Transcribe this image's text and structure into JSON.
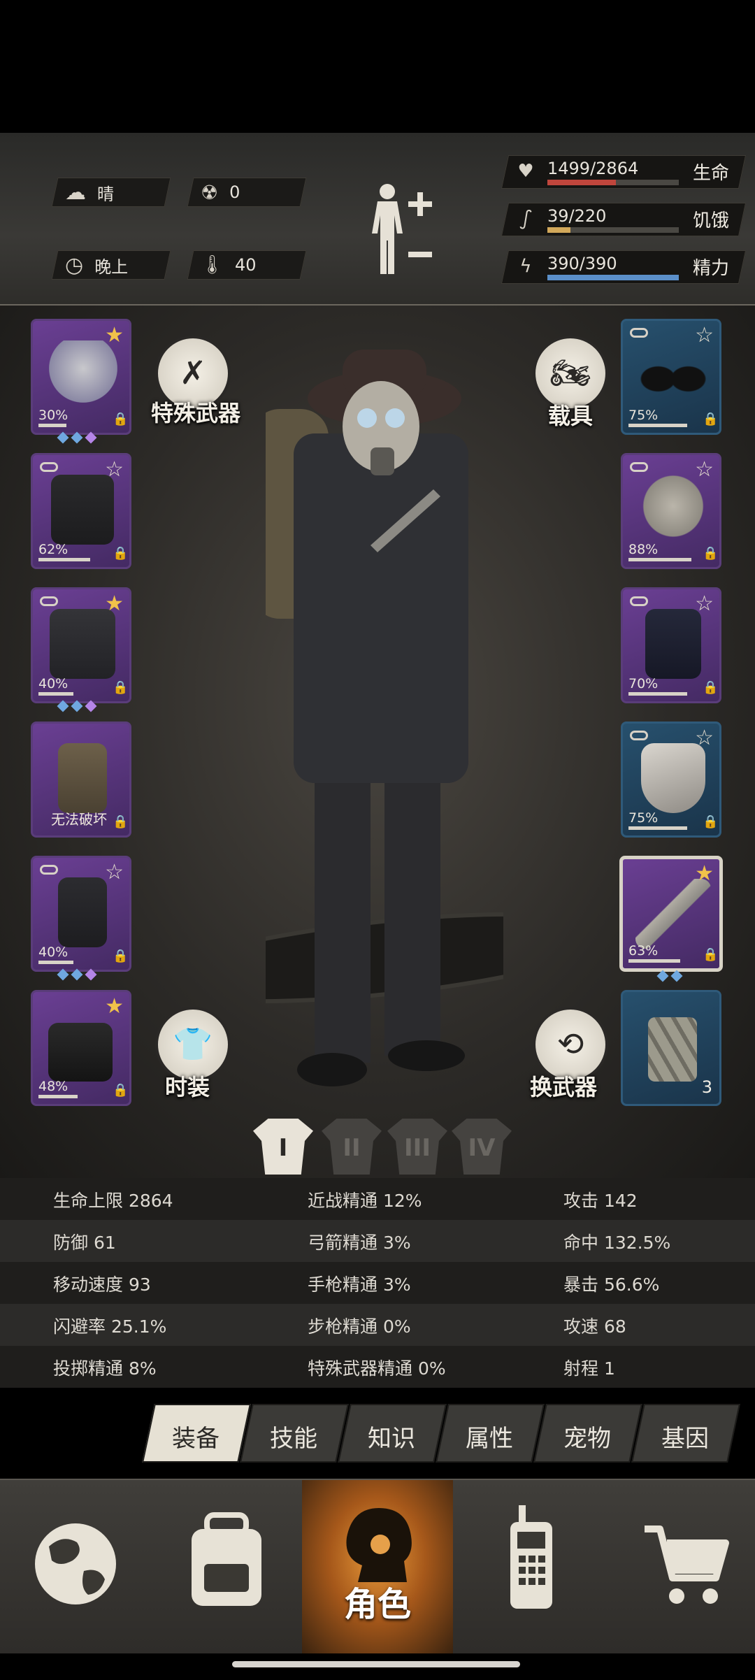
{
  "environment": {
    "weather": "晴",
    "radiation": "0",
    "time_of_day": "晚上",
    "temperature": "40"
  },
  "vitals": [
    {
      "name": "生命",
      "value": "1499/2864",
      "fraction": 0.523,
      "color": "#c0463c",
      "icon": "heart-icon"
    },
    {
      "name": "饥饿",
      "value": "39/220",
      "fraction": 0.177,
      "color": "#d2a85a",
      "icon": "stomach-icon"
    },
    {
      "name": "精力",
      "value": "390/390",
      "fraction": 1.0,
      "color": "#5b8fc9",
      "icon": "lightning-icon"
    }
  ],
  "buttons": {
    "special_weapon": "特殊武器",
    "vehicle": "载具",
    "fashion": "时装",
    "switch_weapon": "换武器"
  },
  "left_slots": [
    {
      "name": "helmet",
      "percent": "30%",
      "star": "filled",
      "gems": 3
    },
    {
      "name": "shirt",
      "percent": "62%",
      "star": "hollow",
      "gems": 0
    },
    {
      "name": "jacket",
      "percent": "40%",
      "star": "filled",
      "gems": 3
    },
    {
      "name": "backpack",
      "note": "无法破坏",
      "star": "none",
      "gems": 0
    },
    {
      "name": "pants",
      "percent": "40%",
      "star": "hollow",
      "gems": 3
    },
    {
      "name": "boots",
      "percent": "48%",
      "star": "filled",
      "gems": 0
    }
  ],
  "right_slots": [
    {
      "name": "goggles",
      "percent": "75%",
      "star": "hollow",
      "color": "blue"
    },
    {
      "name": "gas-mask",
      "percent": "88%",
      "star": "hollow",
      "color": "purple"
    },
    {
      "name": "police-vest",
      "percent": "70%",
      "star": "hollow",
      "color": "purple"
    },
    {
      "name": "shield",
      "percent": "75%",
      "star": "hollow",
      "color": "blue"
    },
    {
      "name": "machete",
      "percent": "63%",
      "star": "filled",
      "color": "purple",
      "gems": 2
    },
    {
      "name": "bandage",
      "count": "3",
      "color": "blue"
    }
  ],
  "outfits": [
    "I",
    "II",
    "III",
    "IV"
  ],
  "stats": [
    [
      "生命上限 2864",
      "近战精通 12%",
      "攻击 142"
    ],
    [
      "防御 61",
      "弓箭精通 3%",
      "命中 132.5%"
    ],
    [
      "移动速度 93",
      "手枪精通 3%",
      "暴击 56.6%"
    ],
    [
      "闪避率 25.1%",
      "步枪精通 0%",
      "攻速 68"
    ],
    [
      "投掷精通 8%",
      "特殊武器精通 0%",
      "射程 1"
    ]
  ],
  "tabs": [
    "装备",
    "技能",
    "知识",
    "属性",
    "宠物",
    "基因"
  ],
  "nav": {
    "world": "",
    "backpack": "",
    "character": "角色",
    "radio": "",
    "shop": ""
  }
}
